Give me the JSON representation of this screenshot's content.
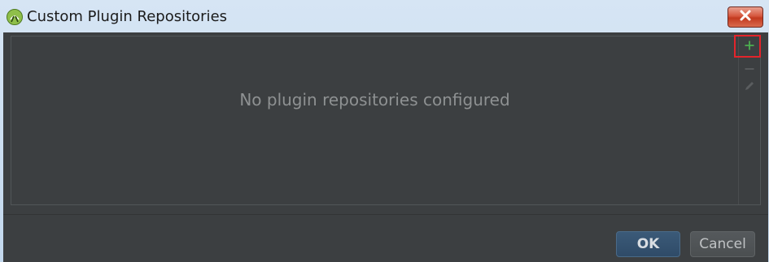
{
  "window": {
    "title": "Custom Plugin Repositories",
    "app_icon": "android-studio-icon",
    "close_icon": "close-x-icon"
  },
  "repositories_panel": {
    "empty_text": "No plugin repositories configured",
    "repositories": [],
    "toolbar": [
      {
        "name": "add",
        "icon": "plus-icon",
        "symbol": "+",
        "color": "#4caf50",
        "enabled": true,
        "highlighted": true
      },
      {
        "name": "remove",
        "icon": "minus-icon",
        "symbol": "−",
        "color": "#5a5d5f",
        "enabled": false
      },
      {
        "name": "edit",
        "icon": "pencil-icon",
        "color": "#5a5d5f",
        "enabled": false
      }
    ]
  },
  "buttons": {
    "ok_label": "OK",
    "cancel_label": "Cancel"
  },
  "colors": {
    "dialog_background": "#3c3f41",
    "highlight_box": "#e3242b",
    "ok_button": "#2f4b68"
  }
}
